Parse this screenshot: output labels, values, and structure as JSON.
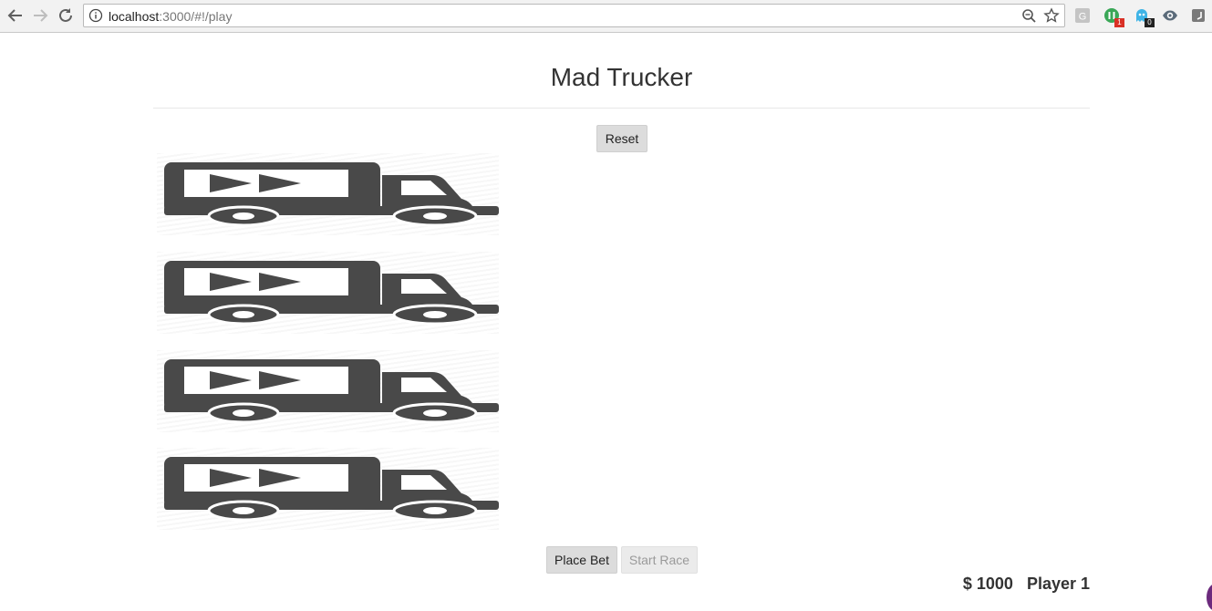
{
  "browser": {
    "url_host": "localhost",
    "url_path": ":3000/#!/play",
    "extensions": [
      {
        "name": "g-extension-icon",
        "badge": ""
      },
      {
        "name": "green-extension-icon",
        "badge": "1"
      },
      {
        "name": "ghost-extension-icon",
        "badge": "0"
      },
      {
        "name": "eye-extension-icon",
        "badge": ""
      },
      {
        "name": "note-extension-icon",
        "badge": ""
      }
    ]
  },
  "page": {
    "title": "Mad Trucker",
    "reset_label": "Reset",
    "place_bet_label": "Place Bet",
    "start_race_label": "Start Race",
    "balance": "$ 1000",
    "player": "Player 1"
  },
  "trucks": [
    {
      "icon": "truck-icon"
    },
    {
      "icon": "truck-icon"
    },
    {
      "icon": "truck-icon"
    },
    {
      "icon": "truck-icon"
    }
  ],
  "colors": {
    "truck": "#494949",
    "button_bg": "#dcdcdc",
    "button_disabled_bg": "#ebebeb",
    "accent_corner": "#6c2a7d",
    "ext_green": "#3aa757",
    "ext_badge_red": "#d93025",
    "ext_ghost": "#3fb4e6"
  }
}
